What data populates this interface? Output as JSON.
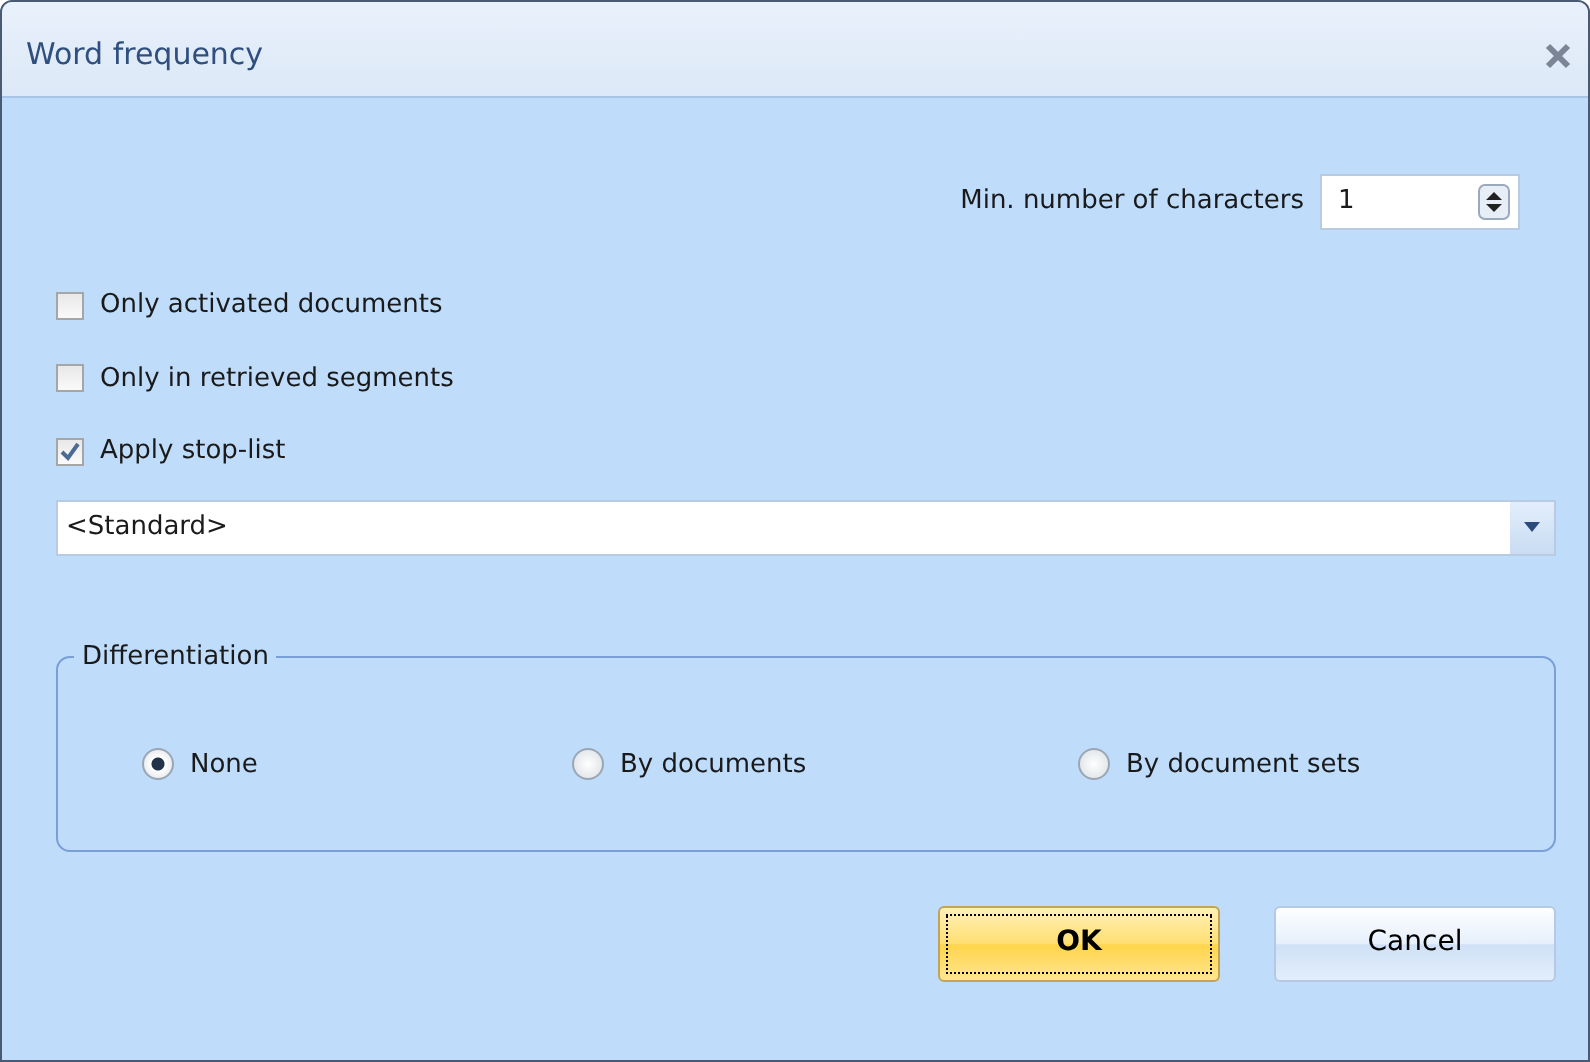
{
  "window": {
    "title": "Word frequency"
  },
  "min_characters": {
    "label": "Min. number of characters",
    "value": "1"
  },
  "checkboxes": [
    {
      "label": "Only activated documents",
      "checked": false
    },
    {
      "label": "Only in retrieved segments",
      "checked": false
    },
    {
      "label": "Apply stop-list",
      "checked": true
    }
  ],
  "stop_list": {
    "value": "<Standard>"
  },
  "differentiation": {
    "title": "Differentiation",
    "options": [
      {
        "label": "None",
        "selected": true
      },
      {
        "label": "By documents",
        "selected": false
      },
      {
        "label": "By document sets",
        "selected": false
      }
    ]
  },
  "buttons": [
    {
      "label": "OK",
      "default": true
    },
    {
      "label": "Cancel",
      "default": false
    }
  ]
}
